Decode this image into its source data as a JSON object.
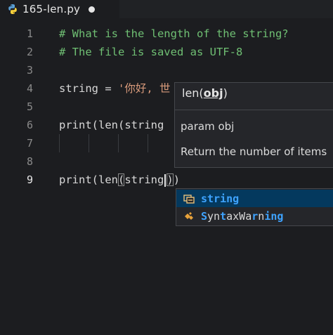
{
  "tab": {
    "filename": "165-len.py",
    "icon": "python-icon",
    "dirty": true
  },
  "editor": {
    "line_numbers": [
      "1",
      "2",
      "3",
      "4",
      "5",
      "6",
      "7",
      "8",
      "9"
    ],
    "active_line": "9",
    "lines": {
      "l1": "# What is the length of the string?",
      "l2": "# The file is saved as UTF-8",
      "l4_var": "string = ",
      "l4_str": "'你好, 世",
      "l6": "print(len(string",
      "l9_a": "print(len",
      "l9_b": "(",
      "l9_c": "string",
      "l9_d": ")",
      "l9_e": ")"
    }
  },
  "hover": {
    "signature_prefix": "len(",
    "signature_param": "obj",
    "signature_suffix": ")",
    "param_text": "param obj",
    "doc_text": "Return the number of items"
  },
  "suggest": {
    "items": [
      {
        "label_parts": [
          "string"
        ],
        "highlight": [
          true
        ],
        "icon": "variable-icon"
      },
      {
        "label_parts": [
          "S",
          "yn",
          "t",
          "axWa",
          "r",
          "n",
          "in",
          "g"
        ],
        "highlight": [
          true,
          false,
          true,
          false,
          true,
          false,
          true,
          true
        ],
        "icon": "class-icon"
      }
    ]
  },
  "colors": {
    "background": "#1c1d20",
    "comment": "#6fbf73",
    "string": "#d89a7b",
    "match_highlight": "#3ea3ff",
    "selected_item": "#04395e"
  }
}
